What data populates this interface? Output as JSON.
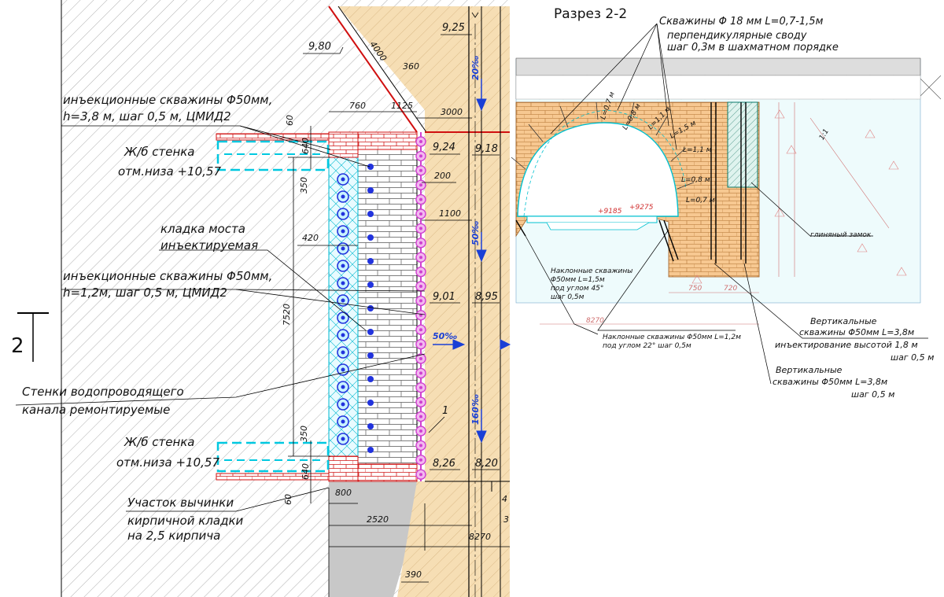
{
  "plan": {
    "level_labels": [
      "9,80",
      "9,25",
      "9,24",
      "9,18",
      "9,01",
      "8,95",
      "8,26",
      "8,20"
    ],
    "dimensions": [
      "4000",
      "360",
      "60",
      "640",
      "760",
      "1125",
      "3000",
      "200",
      "1100",
      "350",
      "420",
      "7520",
      "350",
      "640",
      "60",
      "800",
      "2520",
      "8270",
      "390",
      "4",
      "3"
    ],
    "slopes": [
      "20‰",
      "50‰",
      "50‰",
      "160‰"
    ],
    "notes": {
      "holes_top": "инъекционные скважины Φ50мм,",
      "holes_top_2": "h=3,8 м, шаг 0,5 м, ЦМИД2",
      "rc_wall_top": "Ж/б стенка",
      "rc_wall_top_2": "отм.низа +10,57",
      "bridge": "кладка моста",
      "bridge_2": "инъектируемая",
      "holes_mid": "инъекционные скважины Φ50мм,",
      "holes_mid_2": "h=1,2м, шаг 0,5 м, ЦМИД2",
      "canal": "Стенки водопроводящего",
      "canal_2": "канала ремонтируемые",
      "rc_wall_bot": "Ж/б стенка",
      "rc_wall_bot_2": "отм.низа +10,57",
      "removal": "Участок вычинки",
      "removal_2": "кирпичной кладки",
      "removal_3": "на 2,5 кирпича"
    },
    "marker_1": "1",
    "section_mark": "2"
  },
  "section": {
    "title": "Разрез 2-2",
    "top_note": "Скважины Φ 18 мм L=0,7-1,5м",
    "top_note_2": "перпендикулярные своду",
    "top_note_3": "шаг 0,3м в шахматном порядке",
    "lengths": [
      "L=0,7 м",
      "L=0,8 м",
      "L=1,1 м",
      "L=1,5 м",
      "L=1,1 м",
      "L=0,8 м",
      "L=0,7 м"
    ],
    "levels": [
      "+9185",
      "+9275"
    ],
    "dims_bottom": [
      "750",
      "720",
      "8270"
    ],
    "clay_lock": "глиняный замок",
    "angle": "1:1",
    "inclined_45": "Наклонные скважины",
    "inclined_45_2": "Φ50мм L=1,5м",
    "inclined_45_3": "под углом 45°",
    "inclined_45_4": "шаг 0,5м",
    "inclined_22": "Наклонные скважины Φ50мм L=1,2м",
    "inclined_22_2": "под углом 22° шаг 0,5м",
    "vertical_a": "Вертикальные",
    "vertical_a_2": "скважины Φ50мм L=3,8м",
    "vertical_a_3": "инъектирование высотой 1,8 м",
    "vertical_a_4": "шаг 0,5 м",
    "vertical_b": "Вертикальные",
    "vertical_b_2": "скважины Φ50мм L=3,8м",
    "vertical_b_3": "шаг 0,5 м"
  },
  "colors": {
    "hole": "#2233dd",
    "pink_hole": "#d040d0",
    "cyan": "#00c8e0",
    "red": "#e01010",
    "sand": "#f4dcb0"
  }
}
